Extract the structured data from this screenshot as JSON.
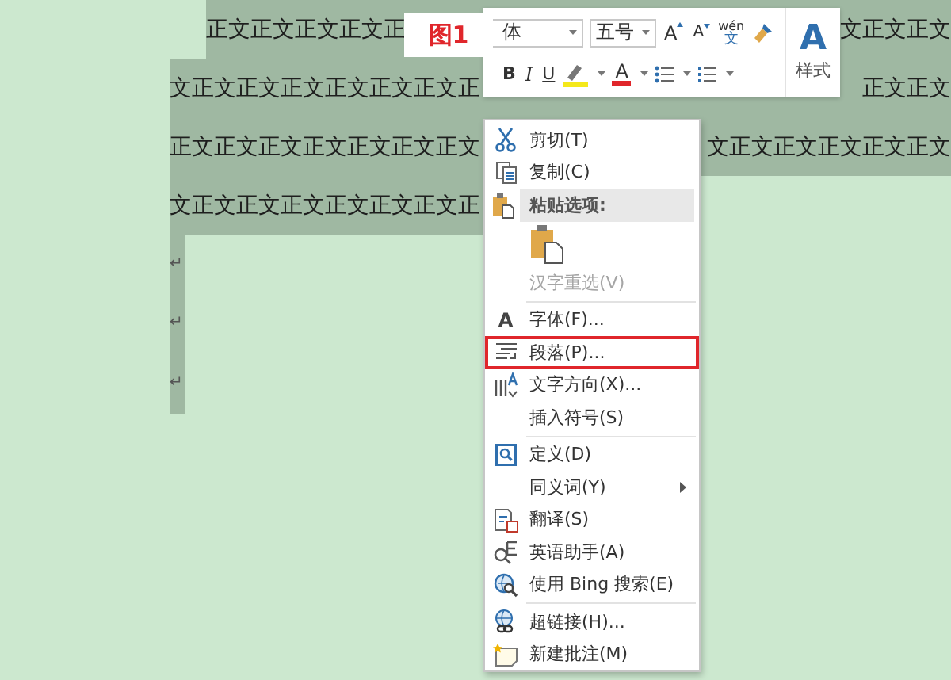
{
  "document": {
    "lines": [
      {
        "left": "正文正文正文正文正",
        "right": "文正文正文",
        "selected": true,
        "indented": true
      },
      {
        "left": "文正文正文正文正文正文正文正",
        "right": "正文正文",
        "selected": true,
        "indented": false
      },
      {
        "left": "正文正文正文正文正文正文正文",
        "right": "文正文正文正文正文正文",
        "selected": true,
        "indented": false
      },
      {
        "left": "文正文正文正文正文正文正文正",
        "selected": true,
        "indented": false
      }
    ],
    "paragraph_marks": [
      {
        "mark": "↵",
        "selected": true
      },
      {
        "mark": "↵",
        "selected": true
      },
      {
        "mark": "↵",
        "selected": true
      }
    ]
  },
  "figure_label": "图1",
  "mini_toolbar": {
    "font": "体",
    "size": "五号",
    "grow": "A",
    "shrink": "A",
    "phonetic_top": "wén",
    "phonetic_char": "文",
    "bold": "B",
    "italic": "I",
    "underline": "U",
    "font_color": "A",
    "styles_glyph": "A",
    "styles_label": "样式"
  },
  "context_menu": {
    "items": [
      {
        "kind": "item",
        "label": "剪切(T)",
        "disabled": false,
        "selected": false,
        "submenu": false
      },
      {
        "kind": "item",
        "label": "复制(C)",
        "disabled": false,
        "selected": false,
        "submenu": false
      },
      {
        "kind": "header",
        "label": "粘贴选项:"
      },
      {
        "kind": "paste"
      },
      {
        "kind": "item",
        "label": "汉字重选(V)",
        "disabled": true,
        "selected": false,
        "submenu": false
      },
      {
        "kind": "separator"
      },
      {
        "kind": "item",
        "label": "字体(F)...",
        "icon_text": "A",
        "disabled": false,
        "selected": false,
        "submenu": false
      },
      {
        "kind": "item",
        "label": "段落(P)...",
        "disabled": false,
        "selected": true,
        "submenu": false
      },
      {
        "kind": "item",
        "label": "文字方向(X)...",
        "disabled": false,
        "selected": false,
        "submenu": false
      },
      {
        "kind": "item",
        "label": "插入符号(S)",
        "disabled": false,
        "selected": false,
        "submenu": false
      },
      {
        "kind": "separator"
      },
      {
        "kind": "item",
        "label": "定义(D)",
        "disabled": false,
        "selected": false,
        "submenu": false
      },
      {
        "kind": "item",
        "label": "同义词(Y)",
        "disabled": false,
        "selected": false,
        "submenu": true
      },
      {
        "kind": "item",
        "label": "翻译(S)",
        "disabled": false,
        "selected": false,
        "submenu": false
      },
      {
        "kind": "item",
        "label": "英语助手(A)",
        "disabled": false,
        "selected": false,
        "submenu": false
      },
      {
        "kind": "item",
        "label": "使用 Bing 搜索(E)",
        "disabled": false,
        "selected": false,
        "submenu": false
      },
      {
        "kind": "separator"
      },
      {
        "kind": "item",
        "label": "超链接(H)...",
        "disabled": false,
        "selected": false,
        "submenu": false
      },
      {
        "kind": "item",
        "label": "新建批注(M)",
        "disabled": false,
        "selected": false,
        "submenu": false
      }
    ]
  }
}
